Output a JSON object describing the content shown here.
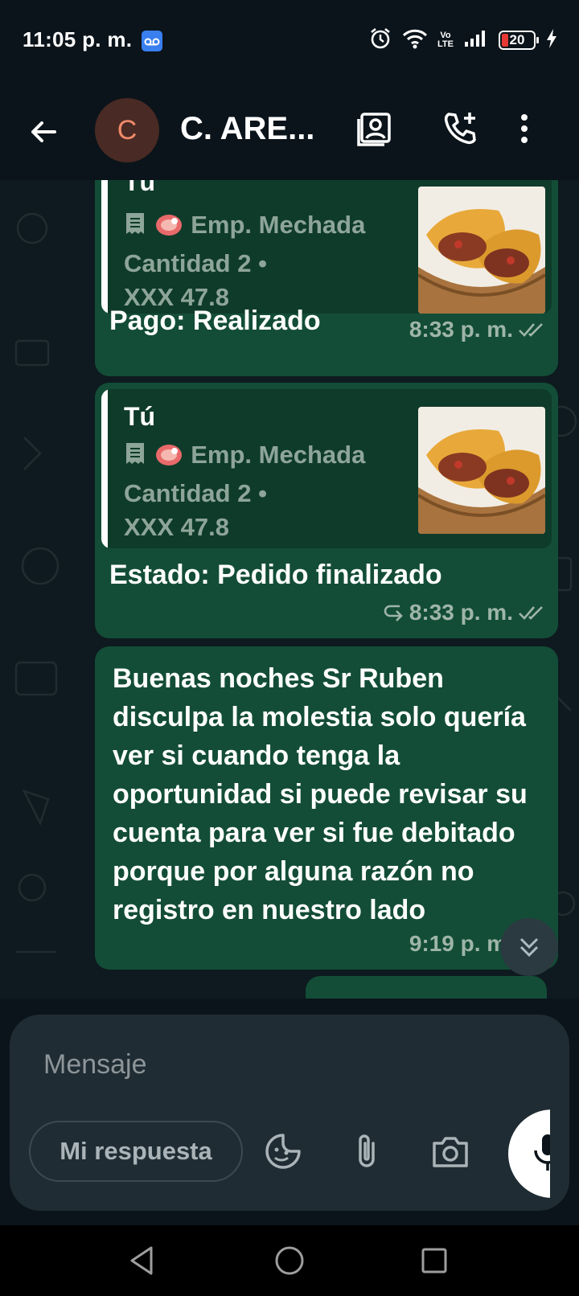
{
  "status_bar": {
    "time": "11:05 p. m.",
    "volte": "Vo\nLTE",
    "battery": "20",
    "icons": [
      "voicemail-icon",
      "alarm-icon",
      "wifi-icon",
      "signal-icon",
      "battery-icon",
      "charging-icon"
    ]
  },
  "header": {
    "avatar_letter": "C",
    "contact_name": "C. ARE...",
    "icons": [
      "back-arrow-icon",
      "contact-card-icon",
      "add-call-icon",
      "more-vert-icon"
    ]
  },
  "messages": [
    {
      "quote_author": "Tú",
      "quote_item": "Emp. Mechada",
      "quote_qty": "Cantidad 2 •",
      "quote_price": "XXX 47.8",
      "caption": "Pago: Realizado",
      "time": "8:33 p. m."
    },
    {
      "quote_author": "Tú",
      "quote_item": "Emp. Mechada",
      "quote_qty": "Cantidad 2 •",
      "quote_price": "XXX 47.8",
      "caption": "Estado: Pedido finalizado",
      "time": "8:33 p. m."
    },
    {
      "text": "Buenas noches Sr Ruben disculpa la molestia solo quería ver si cuando tenga la oportunidad si puede revisar su cuenta para ver si fue debitado porque por alguna razón no registro en nuestro lado",
      "time": "9:19 p. m."
    }
  ],
  "composer": {
    "placeholder": "Mensaje",
    "reply_chip": "Mi respuesta"
  },
  "colors": {
    "background": "#0b141a",
    "outgoing_bubble": "#134d37",
    "quote_bg": "#0f3b2b",
    "composer": "#1f2c33",
    "avatar_text": "#f08a6a"
  }
}
